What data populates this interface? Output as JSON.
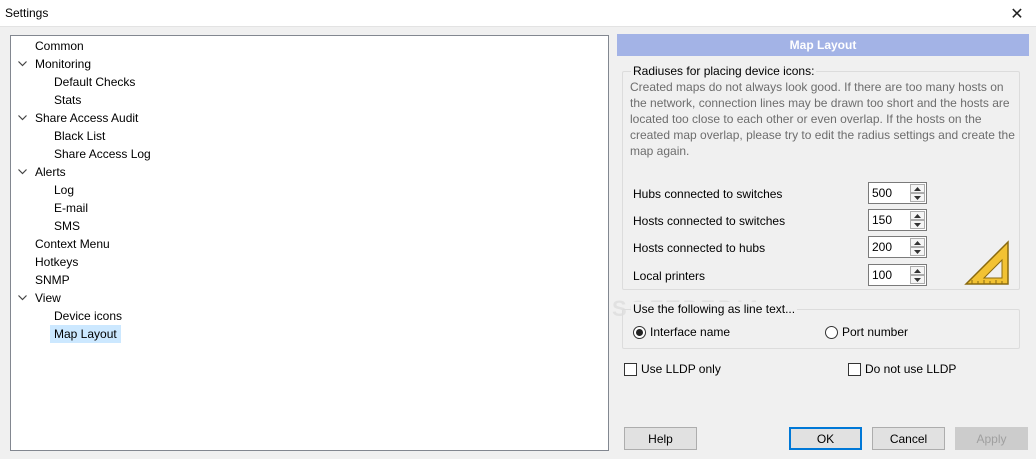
{
  "window": {
    "title": "Settings",
    "close_glyph": "✕"
  },
  "tree": {
    "items": [
      {
        "label": "Common",
        "level": 0,
        "expandable": false,
        "selected": false
      },
      {
        "label": "Monitoring",
        "level": 0,
        "expandable": true,
        "selected": false
      },
      {
        "label": "Default Checks",
        "level": 1,
        "expandable": false,
        "selected": false
      },
      {
        "label": "Stats",
        "level": 1,
        "expandable": false,
        "selected": false
      },
      {
        "label": "Share Access Audit",
        "level": 0,
        "expandable": true,
        "selected": false
      },
      {
        "label": "Black List",
        "level": 1,
        "expandable": false,
        "selected": false
      },
      {
        "label": "Share Access Log",
        "level": 1,
        "expandable": false,
        "selected": false
      },
      {
        "label": "Alerts",
        "level": 0,
        "expandable": true,
        "selected": false
      },
      {
        "label": "Log",
        "level": 1,
        "expandable": false,
        "selected": false
      },
      {
        "label": "E-mail",
        "level": 1,
        "expandable": false,
        "selected": false
      },
      {
        "label": "SMS",
        "level": 1,
        "expandable": false,
        "selected": false
      },
      {
        "label": "Context Menu",
        "level": 0,
        "expandable": false,
        "selected": false
      },
      {
        "label": "Hotkeys",
        "level": 0,
        "expandable": false,
        "selected": false
      },
      {
        "label": "SNMP",
        "level": 0,
        "expandable": false,
        "selected": false
      },
      {
        "label": "View",
        "level": 0,
        "expandable": true,
        "selected": false
      },
      {
        "label": "Device icons",
        "level": 1,
        "expandable": false,
        "selected": false
      },
      {
        "label": "Map Layout",
        "level": 1,
        "expandable": false,
        "selected": true
      }
    ]
  },
  "panel": {
    "header": "Map Layout",
    "radius_group": {
      "title": "Radiuses for placing device icons:",
      "description": "Created maps do not always look good. If there are too many hosts on the network, connection lines may be drawn too short and the hosts are located too close to each other or even overlap. If the hosts on the created map overlap, please try to edit the radius settings and create the map again.",
      "fields": [
        {
          "label": "Hubs connected to switches",
          "value": "500"
        },
        {
          "label": "Hosts connected to switches",
          "value": "150"
        },
        {
          "label": "Hosts connected to hubs",
          "value": "200"
        },
        {
          "label": "Local printers",
          "value": "100"
        }
      ]
    },
    "line_text_group": {
      "title": "Use the following as line text...",
      "options": [
        {
          "label": "Interface name",
          "selected": true
        },
        {
          "label": "Port number",
          "selected": false
        }
      ]
    },
    "checkboxes": {
      "lldp_only": "Use LLDP only",
      "no_lldp": "Do not use LLDP"
    },
    "watermark": "SOFTPEDIA"
  },
  "buttons": {
    "help": "Help",
    "ok": "OK",
    "cancel": "Cancel",
    "apply": "Apply"
  },
  "colors": {
    "header_bg": "#a3b3e6",
    "selection_bg": "#cce8ff",
    "accent": "#0078d7"
  }
}
